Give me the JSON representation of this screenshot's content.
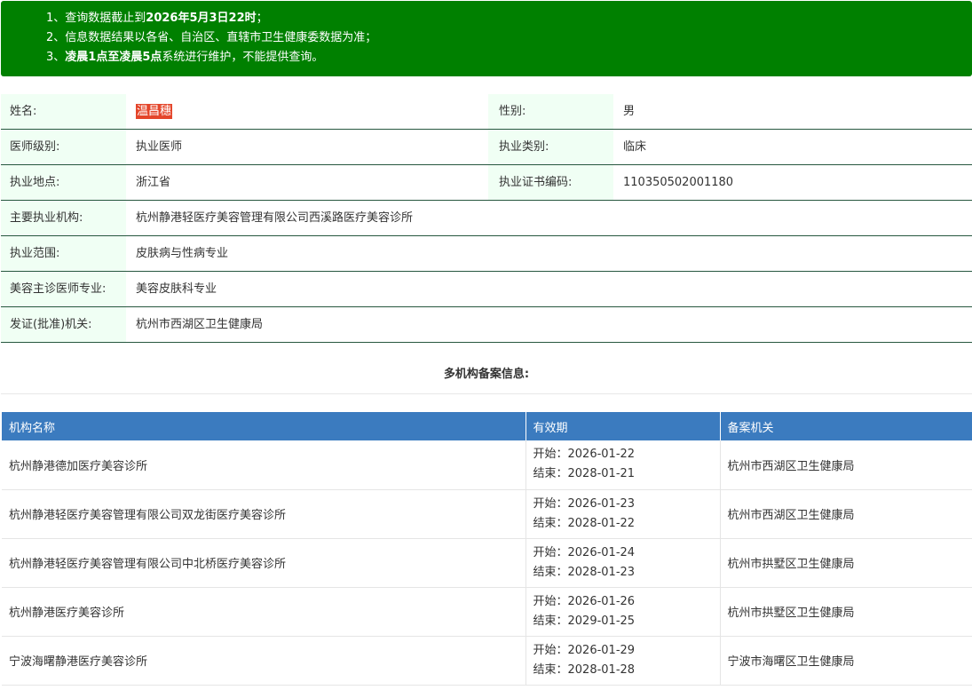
{
  "notice": {
    "line1_prefix": "1、查询数据截止到",
    "line1_bold": "2026年5月3日22时",
    "line1_suffix": "；",
    "line2": "2、信息数据结果以各省、自治区、直辖市卫生健康委数据为准；",
    "line3_prefix": "3、",
    "line3_bold": "凌晨1点至凌晨5点",
    "line3_suffix": "系统进行维护，不能提供查询。"
  },
  "info": {
    "name_label": "姓名:",
    "name_value": "温昌穗",
    "gender_label": "性别:",
    "gender_value": "男",
    "level_label": "医师级别:",
    "level_value": "执业医师",
    "category_label": "执业类别:",
    "category_value": "临床",
    "location_label": "执业地点:",
    "location_value": "浙江省",
    "cert_label": "执业证书编码:",
    "cert_value": "110350502001180",
    "org_label": "主要执业机构:",
    "org_value": "杭州静港轻医疗美容管理有限公司西溪路医疗美容诊所",
    "scope_label": "执业范围:",
    "scope_value": "皮肤病与性病专业",
    "cosmetic_label": "美容主诊医师专业:",
    "cosmetic_value": "美容皮肤科专业",
    "issuer_label": "发证(批准)机关:",
    "issuer_value": "杭州市西湖区卫生健康局"
  },
  "multi_title": "多机构备案信息:",
  "table": {
    "headers": [
      "机构名称",
      "有效期",
      "备案机关"
    ],
    "start_prefix": "开始：",
    "end_prefix": "结束：",
    "rows": [
      {
        "org": "杭州静港德加医疗美容诊所",
        "start": "2026-01-22",
        "end": "2028-01-21",
        "agency": "杭州市西湖区卫生健康局"
      },
      {
        "org": "杭州静港轻医疗美容管理有限公司双龙街医疗美容诊所",
        "start": "2026-01-23",
        "end": "2028-01-22",
        "agency": "杭州市西湖区卫生健康局"
      },
      {
        "org": "杭州静港轻医疗美容管理有限公司中北桥医疗美容诊所",
        "start": "2026-01-24",
        "end": "2028-01-23",
        "agency": "杭州市拱墅区卫生健康局"
      },
      {
        "org": "杭州静港医疗美容诊所",
        "start": "2026-01-26",
        "end": "2029-01-25",
        "agency": "杭州市拱墅区卫生健康局"
      },
      {
        "org": "宁波海曙静港医疗美容诊所",
        "start": "2026-01-29",
        "end": "2028-01-28",
        "agency": "宁波市海曙区卫生健康局"
      }
    ]
  },
  "colors": {
    "notice_bg": "#008000",
    "label_bg": "#f0fff4",
    "header_bg": "#3b7bbf",
    "name_highlight": "#e4452a"
  }
}
